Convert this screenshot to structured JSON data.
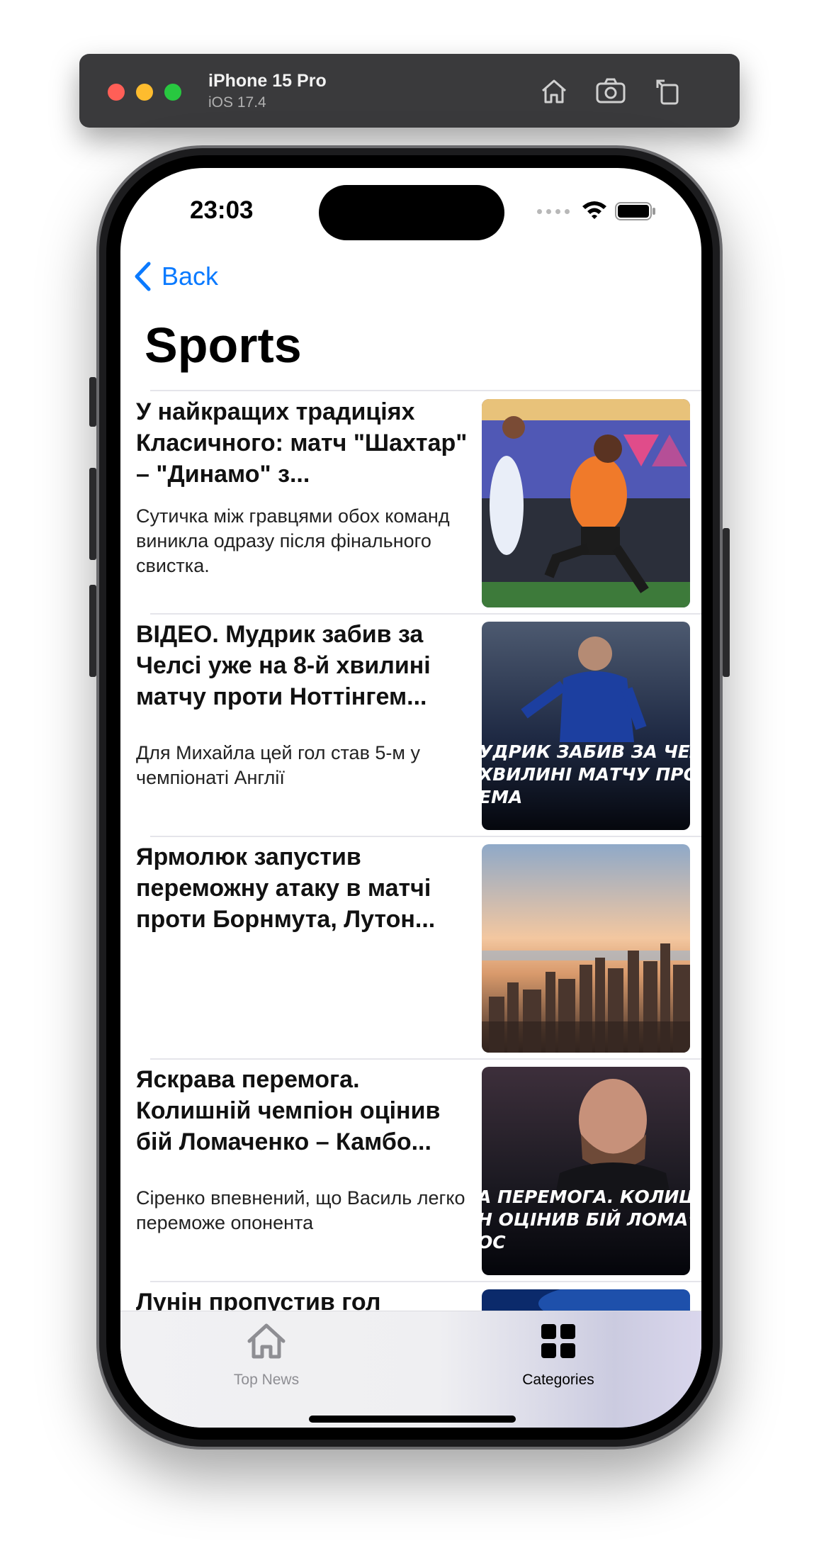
{
  "simulator": {
    "device_name": "iPhone 15 Pro",
    "os_version": "iOS 17.4",
    "toolbar_icons": [
      "home-icon",
      "screenshot-icon",
      "rotate-icon"
    ]
  },
  "status_bar": {
    "time": "23:03",
    "icons": [
      "signal-dots-icon",
      "wifi-icon",
      "battery-icon"
    ]
  },
  "nav": {
    "back_label": "Back",
    "title": "Sports"
  },
  "articles": [
    {
      "headline": "У найкращих традиціях Класичного: матч \"Шахтар\" – \"Динамо\" з...",
      "summary": "Сутичка між гравцями обох команд виникла одразу після фінального свистка.",
      "thumb_overlay": ""
    },
    {
      "headline": "ВІДЕО. Мудрик забив за Челсі уже на 8-й хвилині матчу проти Ноттінгем...",
      "summary": "Для Михайла цей гол став 5-м у чемпіонаті Англії",
      "thumb_overlay": "УДРИК ЗАБИВ ЗА ЧЕЛ ХВИЛИНІ МАТЧУ ПРОТИ ЕМА"
    },
    {
      "headline": "Ярмолюк запустив переможну атаку в матчі проти Борнмута, Лутон...",
      "summary": "",
      "thumb_overlay": ""
    },
    {
      "headline": "Яскрава перемога. Колишній чемпіон оцінив бій Ломаченко – Камбо...",
      "summary": "Сіренко впевнений, що Василь легко переможе опонента",
      "thumb_overlay": "А ПЕРЕМОГА. КОЛИШН Н ОЦІНИВ БІЙ ЛОМАЧЕ ОС"
    },
    {
      "headline": "Лунін пропустив гол",
      "summary": "",
      "thumb_overlay": ""
    }
  ],
  "tabbar": {
    "tabs": [
      {
        "label": "Top News",
        "icon": "house-icon",
        "active": false
      },
      {
        "label": "Categories",
        "icon": "grid-icon",
        "active": true
      }
    ],
    "active_color": "#000000",
    "inactive_color": "#8e8e93"
  },
  "colors": {
    "accent": "#0a7aff"
  }
}
